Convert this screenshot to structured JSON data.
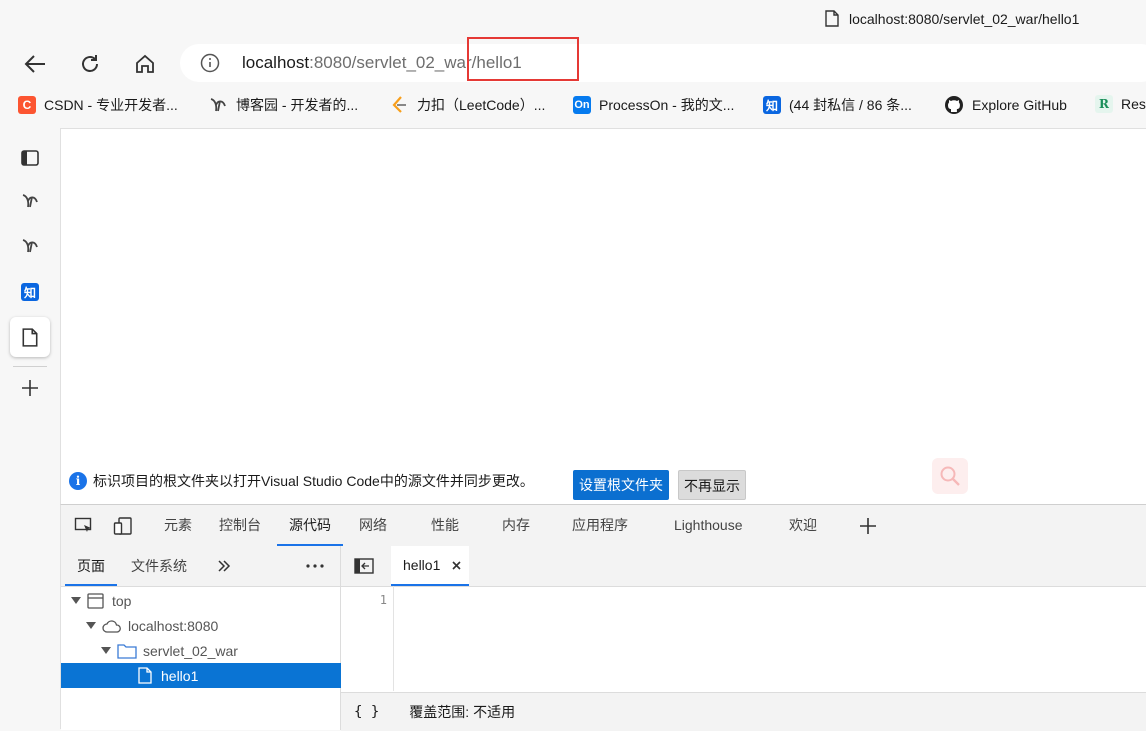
{
  "window": {
    "tab_title": "localhost:8080/servlet_02_war/hello1"
  },
  "address": {
    "host": "localhost",
    "rest": ":8080/servlet_02_war/hello1"
  },
  "bookmarks": [
    {
      "label": "CSDN - 专业开发者...",
      "icon": "csdn-icon",
      "color": "#fc5531"
    },
    {
      "label": "博客园 - 开发者的...",
      "icon": "cnblogs-icon"
    },
    {
      "label": "力扣（LeetCode）...",
      "icon": "leetcode-icon"
    },
    {
      "label": "ProcessOn - 我的文...",
      "icon": "processon-icon",
      "color": "#067bef"
    },
    {
      "label": "(44 封私信 / 86 条...",
      "icon": "zhihu-icon",
      "color": "#0a66e0"
    },
    {
      "label": "Explore GitHub",
      "icon": "github-icon"
    },
    {
      "label": "Res",
      "icon": "researchgate-icon"
    }
  ],
  "bookmark_glyphs": {
    "csdn": "C",
    "processon": "On",
    "zhihu": "知",
    "research": "R"
  },
  "sidebar": {
    "zhihu_glyph": "知"
  },
  "notice": {
    "text": "标识项目的根文件夹以打开Visual Studio Code中的源文件并同步更改。",
    "set_root_label": "设置根文件夹",
    "dismiss_label": "不再显示"
  },
  "devtools": {
    "tabs": [
      "元素",
      "控制台",
      "源代码",
      "网络",
      "性能",
      "内存",
      "应用程序",
      "Lighthouse",
      "欢迎"
    ],
    "active_tab": "源代码",
    "nav_tabs": [
      "页面",
      "文件系统"
    ],
    "tree": [
      {
        "label": "top"
      },
      {
        "label": "localhost:8080"
      },
      {
        "label": "servlet_02_war"
      },
      {
        "label": "hello1"
      }
    ],
    "editor_tab": "hello1",
    "line_number": "1",
    "status_braces": "{ }",
    "status_text": "覆盖范围: 不适用"
  },
  "colors": {
    "accent": "#1a73e8",
    "highlight_box": "#e53935",
    "selection": "#0a74d4"
  }
}
